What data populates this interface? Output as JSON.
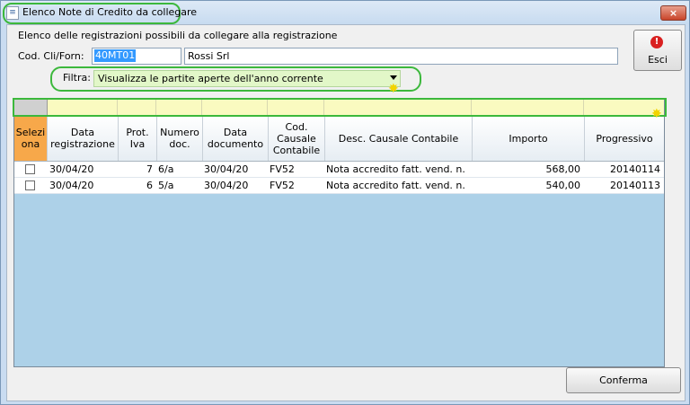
{
  "window": {
    "title": "Elenco Note di Credito da collegare",
    "close_label": "×"
  },
  "heading": "Elenco delle registrazioni possibili da collegare alla registrazione",
  "cod": {
    "label": "Cod. Cli/Forn:",
    "value": "40MT01",
    "name": "Rossi Srl"
  },
  "filter": {
    "label": "Filtra:",
    "value": "Visualizza le partite aperte dell'anno corrente"
  },
  "esci": {
    "label": "Esci",
    "icon": "exit-icon"
  },
  "table": {
    "headers": [
      "Selezi ona",
      "Data registrazione",
      "Prot. Iva",
      "Numero doc.",
      "Data documento",
      "Cod. Causale Contabile",
      "Desc. Causale Contabile",
      "Importo",
      "Progressivo"
    ],
    "rows": [
      {
        "data_reg": "30/04/20",
        "prot": "7",
        "num": "6/a",
        "data_doc": "30/04/20",
        "cod": "FV52",
        "desc": "Nota accredito fatt. vend. n.",
        "importo": "568,00",
        "progressivo": "20140114"
      },
      {
        "data_reg": "30/04/20",
        "prot": "6",
        "num": "5/a",
        "data_doc": "30/04/20",
        "cod": "FV52",
        "desc": "Nota accredito fatt. vend. n.",
        "importo": "540,00",
        "progressivo": "20140113"
      }
    ]
  },
  "conferma_label": "Conferma",
  "colors": {
    "highlight": "#3cb83c",
    "grid_bg": "#add1e8",
    "select_header": "#f7a84a",
    "filter_bg": "#e2f7c8"
  }
}
